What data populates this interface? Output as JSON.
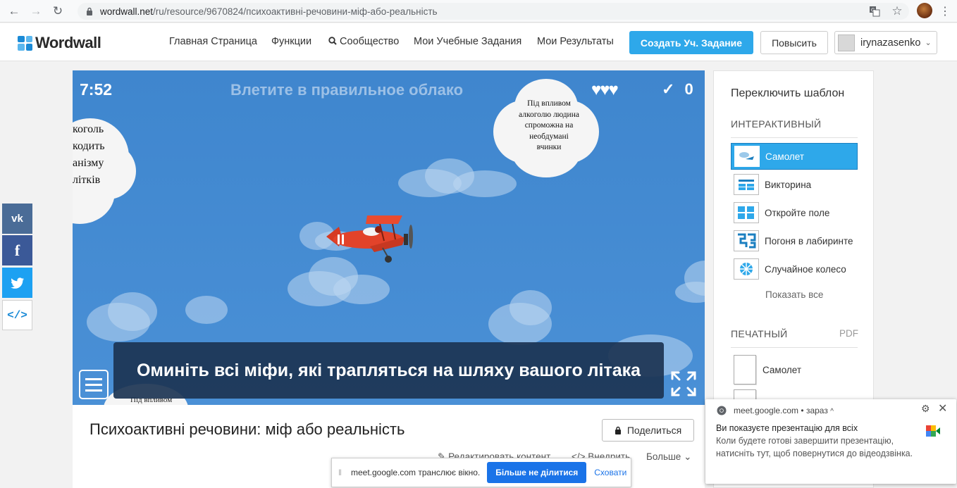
{
  "browser": {
    "url_host": "wordwall.net",
    "url_path": "/ru/resource/9670824/психоактивні-речовини-міф-або-реальність"
  },
  "header": {
    "logo_text": "Wordwall",
    "nav": [
      "Главная Страница",
      "Функции",
      "Сообщество",
      "Мои Учебные Задания",
      "Мои Результаты"
    ],
    "create_button": "Создать Уч. Задание",
    "upgrade_button": "Повысить",
    "username": "irynazasenko"
  },
  "share_sidebar": [
    "vk-icon",
    "facebook-icon",
    "twitter-icon",
    "embed-icon"
  ],
  "game": {
    "timer": "7:52",
    "title": "Влетите в правильное облако",
    "lives": 3,
    "score": "0",
    "cloud_left_lines": [
      "коголь",
      "кодить",
      "анізму",
      "літків"
    ],
    "cloud_right_lines": [
      "Під впливом",
      "алкоголю людина",
      "спроможна на",
      "необдумані",
      "вчинки"
    ],
    "caption": "Оминіть всі міфи, які трапляться на шляху вашого літака",
    "bottom_cloud_text": "Під впливом"
  },
  "activity": {
    "title": "Психоактивні речовини: міф або реальність",
    "share_button": "Поделиться",
    "edit_label": "Редактировать контент",
    "embed_label": "Внедрить",
    "more_label": "Больше"
  },
  "panel": {
    "title": "Переключить шаблон",
    "interactive_label": "ИНТЕРАКТИВНЫЙ",
    "templates": [
      {
        "label": "Самолет",
        "icon": "plane-thumb-icon"
      },
      {
        "label": "Викторина",
        "icon": "quiz-thumb-icon"
      },
      {
        "label": "Откройте поле",
        "icon": "open-box-thumb-icon"
      },
      {
        "label": "Погоня в лабиринте",
        "icon": "maze-thumb-icon"
      },
      {
        "label": "Случайное колесо",
        "icon": "wheel-thumb-icon"
      }
    ],
    "show_all": "Показать все",
    "print_label": "ПЕЧАТНЫЙ",
    "pdf_label": "PDF",
    "print_items": [
      "Самолет"
    ]
  },
  "notification": {
    "source": "meet.google.com",
    "time": "зараз",
    "title": "Ви показуєте презентацію для всіх",
    "body": "Коли будете готові завершити презентацію, натисніть тут, щоб повернутися до відеодзвінка."
  },
  "sharebar": {
    "text": "meet.google.com транслює вікно.",
    "stop_button": "Більше не ділитися",
    "hide_button": "Сховати"
  },
  "colors": {
    "accent": "#2ea8ea",
    "sky": "#4a90d6",
    "plane": "#e2432a",
    "meet_blue": "#1a73e8"
  }
}
